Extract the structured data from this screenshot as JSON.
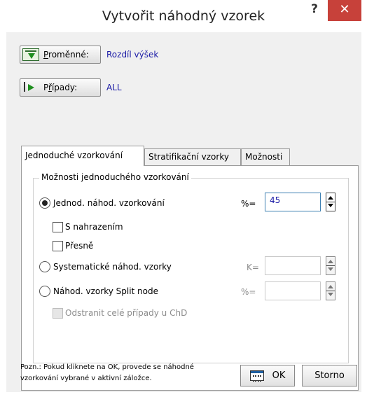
{
  "window": {
    "title": "Vytvořit náhodný vzorek",
    "help_label": "?",
    "close_label": "✕",
    "close_color": "#c7413a"
  },
  "variables": {
    "button_label": "Proměnné:",
    "button_mnemonic": "P",
    "button_rest": "roměnné:",
    "value": "Rozdíl výšek",
    "icon": "variables-icon"
  },
  "cases": {
    "button_label": "Případy:",
    "button_mnemonic": "ř",
    "button_pre": "P",
    "button_rest": "ípady:",
    "value": "ALL",
    "icon": "cases-icon"
  },
  "tabs": [
    {
      "label": "Jednoduché vzorkování",
      "active": true
    },
    {
      "label": "Stratifikační vzorky",
      "active": false
    },
    {
      "label": "Možnosti",
      "active": false
    }
  ],
  "group": {
    "legend": "Možnosti jednoduchého vzorkování",
    "simple_random": {
      "label": "Jednod. náhod. vzorkování",
      "selected": true,
      "field_label": "%=",
      "value": "45"
    },
    "with_replacement": {
      "label": "S nahrazením",
      "checked": false
    },
    "exact": {
      "label": "Přesně",
      "checked": false
    },
    "systematic": {
      "label": "Systematické náhod. vzorky",
      "selected": false,
      "field_label": "K=",
      "value": ""
    },
    "split_node": {
      "label": "Náhod. vzorky Split node",
      "selected": false,
      "field_label": "%=",
      "value": ""
    },
    "remove_cases": {
      "label": "Odstranit celé případy u ChD",
      "checked": false,
      "disabled": true
    }
  },
  "footer": {
    "note_line1": "Pozn.: Pokud kliknete na OK, provede se náhodné",
    "note_line2": "vzorkování vybrané v aktivní záložce.",
    "ok_label": "OK",
    "cancel_label": "Storno",
    "accent_color": "#1a1aa6"
  }
}
